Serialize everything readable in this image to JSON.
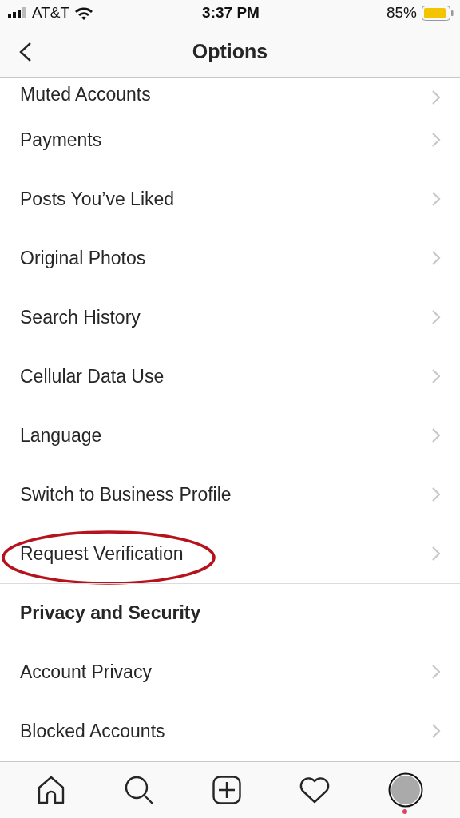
{
  "status_bar": {
    "carrier": "AT&T",
    "time": "3:37 PM",
    "battery": "85%"
  },
  "nav": {
    "title": "Options"
  },
  "options": [
    {
      "kind": "item",
      "label": "Muted Accounts",
      "highlighted": false
    },
    {
      "kind": "item",
      "label": "Payments",
      "highlighted": false
    },
    {
      "kind": "item",
      "label": "Posts You’ve Liked",
      "highlighted": false
    },
    {
      "kind": "item",
      "label": "Original Photos",
      "highlighted": false
    },
    {
      "kind": "item",
      "label": "Search History",
      "highlighted": false
    },
    {
      "kind": "item",
      "label": "Cellular Data Use",
      "highlighted": false
    },
    {
      "kind": "item",
      "label": "Language",
      "highlighted": false
    },
    {
      "kind": "item",
      "label": "Switch to Business Profile",
      "highlighted": false
    },
    {
      "kind": "item",
      "label": "Request Verification",
      "highlighted": true
    },
    {
      "kind": "header",
      "label": "Privacy and Security"
    },
    {
      "kind": "item",
      "label": "Account Privacy",
      "highlighted": false
    },
    {
      "kind": "item",
      "label": "Blocked Accounts",
      "highlighted": false
    }
  ],
  "tab_bar": {
    "profile_notification": true
  }
}
